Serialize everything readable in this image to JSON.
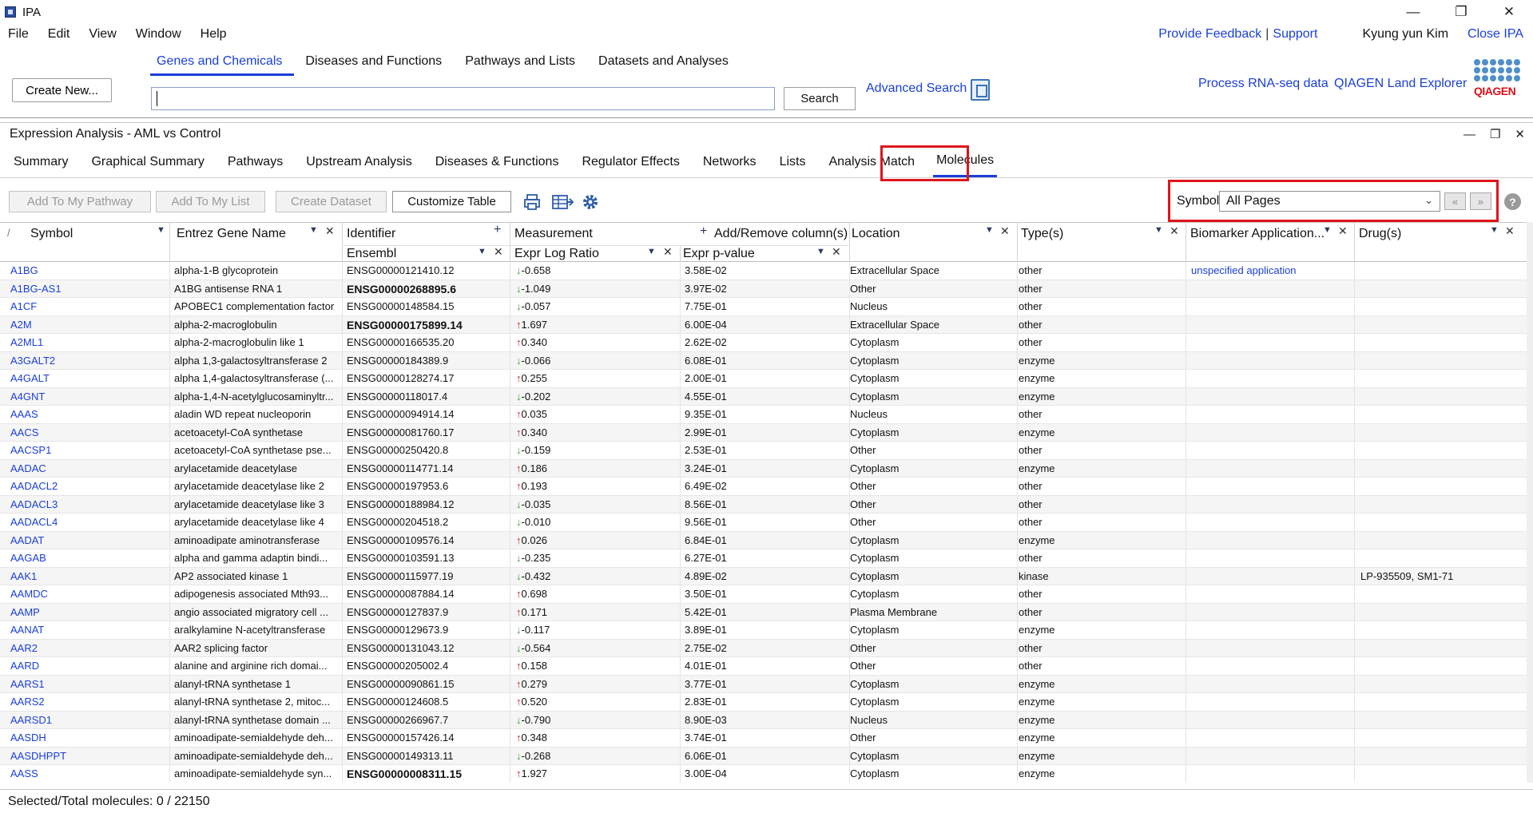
{
  "app": {
    "title": "IPA"
  },
  "window_controls": {
    "minimize": "—",
    "restore": "❐",
    "close": "✕"
  },
  "menu": [
    "File",
    "Edit",
    "View",
    "Window",
    "Help"
  ],
  "top_links": {
    "feedback": "Provide Feedback",
    "separator": "|",
    "support": "Support",
    "user": "Kyung yun Kim",
    "close": "Close IPA"
  },
  "search": {
    "create_new": "Create New...",
    "tabs": [
      "Genes and Chemicals",
      "Diseases and Functions",
      "Pathways and Lists",
      "Datasets and Analyses"
    ],
    "active_tab": "Genes and Chemicals",
    "query": "",
    "button": "Search",
    "advanced": "Advanced Search",
    "process_rnaseq": "Process RNA-seq data",
    "land_explorer": "QIAGEN Land Explorer",
    "logo_text": "QIAGEN"
  },
  "analysis": {
    "title": "Expression Analysis - AML vs Control",
    "tabs": [
      "Summary",
      "Graphical Summary",
      "Pathways",
      "Upstream Analysis",
      "Diseases & Functions",
      "Regulator Effects",
      "Networks",
      "Lists",
      "Analysis Match",
      "Molecules"
    ],
    "active_tab": "Molecules"
  },
  "toolbar": {
    "add_pathway": "Add To My Pathway",
    "add_list": "Add To My List",
    "create_dataset": "Create Dataset",
    "customize": "Customize Table",
    "icons": [
      "print-icon",
      "export-table-icon",
      "settings-gear-icon"
    ],
    "symbol_label": "Symbol",
    "symbol_value": "All Pages",
    "prev_page": "«",
    "next_page": "»",
    "help": "?"
  },
  "table": {
    "headers": {
      "symbol": "Symbol",
      "entrez": "Entrez Gene Name",
      "identifier": "Identifier",
      "identifier_sub": "Ensembl",
      "measurement": "Measurement",
      "add_remove": "Add/Remove column(s)",
      "ratio": "Expr Log Ratio",
      "pvalue": "Expr p-value",
      "location": "Location",
      "type": "Type(s)",
      "biomarker": "Biomarker Application...",
      "drugs": "Drug(s)"
    },
    "colors": {
      "up": "#e0141b",
      "down": "#33a02c",
      "link": "#1a3fd6"
    },
    "rows": [
      {
        "sym": "A1BG",
        "name": "alpha-1-B glycoprotein",
        "id": "ENSG00000121410.12",
        "dir": "down",
        "ratio": "-0.658",
        "p": "3.58E-02",
        "loc": "Extracellular Space",
        "type": "other",
        "bio": "unspecified application",
        "drug": ""
      },
      {
        "sym": "A1BG-AS1",
        "name": "A1BG antisense RNA 1",
        "id": "ENSG00000268895.6",
        "bold": true,
        "dir": "down",
        "ratio": "-1.049",
        "p": "3.97E-02",
        "loc": "Other",
        "type": "other",
        "bio": "",
        "drug": ""
      },
      {
        "sym": "A1CF",
        "name": "APOBEC1 complementation factor",
        "id": "ENSG00000148584.15",
        "dir": "down",
        "ratio": "-0.057",
        "p": "7.75E-01",
        "loc": "Nucleus",
        "type": "other",
        "bio": "",
        "drug": ""
      },
      {
        "sym": "A2M",
        "name": "alpha-2-macroglobulin",
        "id": "ENSG00000175899.14",
        "bold": true,
        "dir": "up",
        "ratio": "1.697",
        "p": "6.00E-04",
        "loc": "Extracellular Space",
        "type": "other",
        "bio": "",
        "drug": ""
      },
      {
        "sym": "A2ML1",
        "name": "alpha-2-macroglobulin like 1",
        "id": "ENSG00000166535.20",
        "dir": "up",
        "ratio": "0.340",
        "p": "2.62E-02",
        "loc": "Cytoplasm",
        "type": "other",
        "bio": "",
        "drug": ""
      },
      {
        "sym": "A3GALT2",
        "name": "alpha 1,3-galactosyltransferase 2",
        "id": "ENSG00000184389.9",
        "dir": "down",
        "ratio": "-0.066",
        "p": "6.08E-01",
        "loc": "Cytoplasm",
        "type": "enzyme",
        "bio": "",
        "drug": ""
      },
      {
        "sym": "A4GALT",
        "name": "alpha 1,4-galactosyltransferase (...",
        "id": "ENSG00000128274.17",
        "dir": "up",
        "ratio": "0.255",
        "p": "2.00E-01",
        "loc": "Cytoplasm",
        "type": "enzyme",
        "bio": "",
        "drug": ""
      },
      {
        "sym": "A4GNT",
        "name": "alpha-1,4-N-acetylglucosaminyltr...",
        "id": "ENSG00000118017.4",
        "dir": "down",
        "ratio": "-0.202",
        "p": "4.55E-01",
        "loc": "Cytoplasm",
        "type": "enzyme",
        "bio": "",
        "drug": ""
      },
      {
        "sym": "AAAS",
        "name": "aladin WD repeat nucleoporin",
        "id": "ENSG00000094914.14",
        "dir": "up",
        "ratio": "0.035",
        "p": "9.35E-01",
        "loc": "Nucleus",
        "type": "other",
        "bio": "",
        "drug": ""
      },
      {
        "sym": "AACS",
        "name": "acetoacetyl-CoA synthetase",
        "id": "ENSG00000081760.17",
        "dir": "up",
        "ratio": "0.340",
        "p": "2.99E-01",
        "loc": "Cytoplasm",
        "type": "enzyme",
        "bio": "",
        "drug": ""
      },
      {
        "sym": "AACSP1",
        "name": "acetoacetyl-CoA synthetase pse...",
        "id": "ENSG00000250420.8",
        "dir": "down",
        "ratio": "-0.159",
        "p": "2.53E-01",
        "loc": "Other",
        "type": "other",
        "bio": "",
        "drug": ""
      },
      {
        "sym": "AADAC",
        "name": "arylacetamide deacetylase",
        "id": "ENSG00000114771.14",
        "dir": "up",
        "ratio": "0.186",
        "p": "3.24E-01",
        "loc": "Cytoplasm",
        "type": "enzyme",
        "bio": "",
        "drug": ""
      },
      {
        "sym": "AADACL2",
        "name": "arylacetamide deacetylase like 2",
        "id": "ENSG00000197953.6",
        "dir": "up",
        "ratio": "0.193",
        "p": "6.49E-02",
        "loc": "Other",
        "type": "other",
        "bio": "",
        "drug": ""
      },
      {
        "sym": "AADACL3",
        "name": "arylacetamide deacetylase like 3",
        "id": "ENSG00000188984.12",
        "dir": "down",
        "ratio": "-0.035",
        "p": "8.56E-01",
        "loc": "Other",
        "type": "other",
        "bio": "",
        "drug": ""
      },
      {
        "sym": "AADACL4",
        "name": "arylacetamide deacetylase like 4",
        "id": "ENSG00000204518.2",
        "dir": "down",
        "ratio": "-0.010",
        "p": "9.56E-01",
        "loc": "Other",
        "type": "other",
        "bio": "",
        "drug": ""
      },
      {
        "sym": "AADAT",
        "name": "aminoadipate aminotransferase",
        "id": "ENSG00000109576.14",
        "dir": "up",
        "ratio": "0.026",
        "p": "6.84E-01",
        "loc": "Cytoplasm",
        "type": "enzyme",
        "bio": "",
        "drug": ""
      },
      {
        "sym": "AAGAB",
        "name": "alpha and gamma adaptin bindi...",
        "id": "ENSG00000103591.13",
        "dir": "down",
        "ratio": "-0.235",
        "p": "6.27E-01",
        "loc": "Cytoplasm",
        "type": "other",
        "bio": "",
        "drug": ""
      },
      {
        "sym": "AAK1",
        "name": "AP2 associated kinase 1",
        "id": "ENSG00000115977.19",
        "dir": "down",
        "ratio": "-0.432",
        "p": "4.89E-02",
        "loc": "Cytoplasm",
        "type": "kinase",
        "bio": "",
        "drug": "LP-935509,   SM1-71"
      },
      {
        "sym": "AAMDC",
        "name": "adipogenesis associated Mth93...",
        "id": "ENSG00000087884.14",
        "dir": "up",
        "ratio": "0.698",
        "p": "3.50E-01",
        "loc": "Cytoplasm",
        "type": "other",
        "bio": "",
        "drug": ""
      },
      {
        "sym": "AAMP",
        "name": "angio associated migratory cell ...",
        "id": "ENSG00000127837.9",
        "dir": "up",
        "ratio": "0.171",
        "p": "5.42E-01",
        "loc": "Plasma Membrane",
        "type": "other",
        "bio": "",
        "drug": ""
      },
      {
        "sym": "AANAT",
        "name": "aralkylamine N-acetyltransferase",
        "id": "ENSG00000129673.9",
        "dir": "down",
        "ratio": "-0.117",
        "p": "3.89E-01",
        "loc": "Cytoplasm",
        "type": "enzyme",
        "bio": "",
        "drug": ""
      },
      {
        "sym": "AAR2",
        "name": "AAR2 splicing factor",
        "id": "ENSG00000131043.12",
        "dir": "down",
        "ratio": "-0.564",
        "p": "2.75E-02",
        "loc": "Other",
        "type": "other",
        "bio": "",
        "drug": ""
      },
      {
        "sym": "AARD",
        "name": "alanine and arginine rich domai...",
        "id": "ENSG00000205002.4",
        "dir": "up",
        "ratio": "0.158",
        "p": "4.01E-01",
        "loc": "Other",
        "type": "other",
        "bio": "",
        "drug": ""
      },
      {
        "sym": "AARS1",
        "name": "alanyl-tRNA synthetase 1",
        "id": "ENSG00000090861.15",
        "dir": "up",
        "ratio": "0.279",
        "p": "3.77E-01",
        "loc": "Cytoplasm",
        "type": "enzyme",
        "bio": "",
        "drug": ""
      },
      {
        "sym": "AARS2",
        "name": "alanyl-tRNA synthetase 2, mitoc...",
        "id": "ENSG00000124608.5",
        "dir": "up",
        "ratio": "0.520",
        "p": "2.83E-01",
        "loc": "Cytoplasm",
        "type": "enzyme",
        "bio": "",
        "drug": ""
      },
      {
        "sym": "AARSD1",
        "name": "alanyl-tRNA synthetase domain ...",
        "id": "ENSG00000266967.7",
        "dir": "down",
        "ratio": "-0.790",
        "p": "8.90E-03",
        "loc": "Nucleus",
        "type": "enzyme",
        "bio": "",
        "drug": ""
      },
      {
        "sym": "AASDH",
        "name": "aminoadipate-semialdehyde deh...",
        "id": "ENSG00000157426.14",
        "dir": "up",
        "ratio": "0.348",
        "p": "3.74E-01",
        "loc": "Other",
        "type": "enzyme",
        "bio": "",
        "drug": ""
      },
      {
        "sym": "AASDHPPT",
        "name": "aminoadipate-semialdehyde deh...",
        "id": "ENSG00000149313.11",
        "dir": "down",
        "ratio": "-0.268",
        "p": "6.06E-01",
        "loc": "Cytoplasm",
        "type": "enzyme",
        "bio": "",
        "drug": ""
      },
      {
        "sym": "AASS",
        "name": "aminoadipate-semialdehyde syn...",
        "id": "ENSG00000008311.15",
        "bold": true,
        "dir": "up",
        "ratio": "1.927",
        "p": "3.00E-04",
        "loc": "Cytoplasm",
        "type": "enzyme",
        "bio": "",
        "drug": ""
      }
    ]
  },
  "status": {
    "text": "Selected/Total molecules: 0 / 22150"
  }
}
